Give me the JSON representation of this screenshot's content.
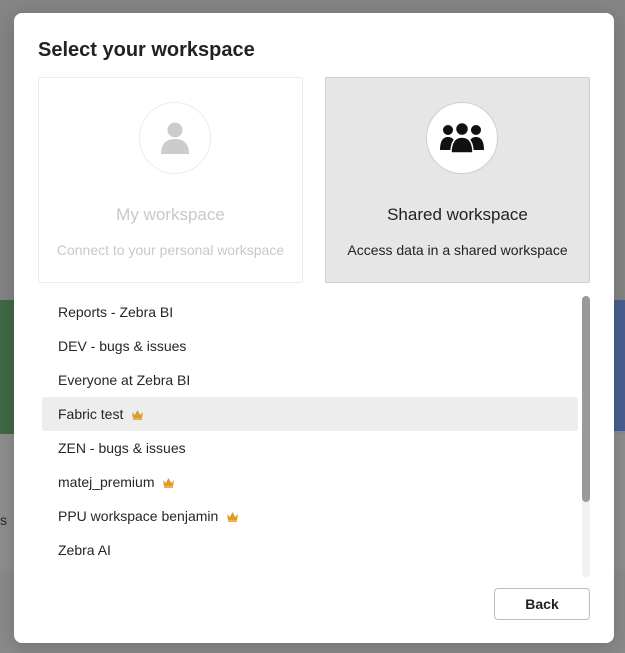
{
  "dialog": {
    "title": "Select your workspace",
    "cards": [
      {
        "title": "My workspace",
        "description": "Connect to your personal workspace",
        "icon": "person-icon",
        "state": "disabled"
      },
      {
        "title": "Shared workspace",
        "description": "Access data in a shared workspace",
        "icon": "group-icon",
        "state": "selected"
      }
    ],
    "workspaces": [
      {
        "name": "Reports - Zebra BI",
        "premium": false
      },
      {
        "name": "DEV - bugs & issues",
        "premium": false
      },
      {
        "name": "Everyone at Zebra BI",
        "premium": false
      },
      {
        "name": "Fabric test",
        "premium": true,
        "selected": true
      },
      {
        "name": "ZEN - bugs & issues",
        "premium": false
      },
      {
        "name": "matej_premium",
        "premium": true
      },
      {
        "name": "PPU workspace benjamin",
        "premium": true
      },
      {
        "name": "Zebra AI",
        "premium": false
      }
    ],
    "back_label": "Back"
  },
  "background": {
    "partial_text": "s"
  },
  "colors": {
    "crown": "#e39b1e",
    "selected_row": "#ededed",
    "selected_card": "#e6e6e6"
  }
}
